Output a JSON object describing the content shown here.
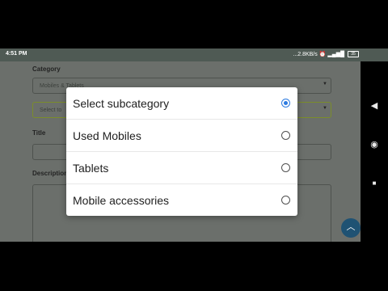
{
  "status_bar": {
    "time": "4:51 PM",
    "net_speed": "...2.8KB/s",
    "signal_icons": "⏰ ▂▄▆█ ",
    "battery": "35"
  },
  "form": {
    "category_label": "Category",
    "category_value": "Mobiles & Tablets",
    "subcategory_value": "Select to",
    "title_label": "Title",
    "description_label": "Description"
  },
  "dialog": {
    "options": [
      {
        "label": "Select subcategory",
        "selected": true
      },
      {
        "label": "Used Mobiles",
        "selected": false
      },
      {
        "label": "Tablets",
        "selected": false
      },
      {
        "label": "Mobile accessories",
        "selected": false
      }
    ]
  },
  "nav": {
    "back_icon": "◀",
    "home_icon": "◉",
    "recents_icon": "■"
  },
  "fab_icon": "︿",
  "colors": {
    "accent": "#2d7be0",
    "fab": "#1f5273",
    "selected_border": "#7b8d2a"
  }
}
